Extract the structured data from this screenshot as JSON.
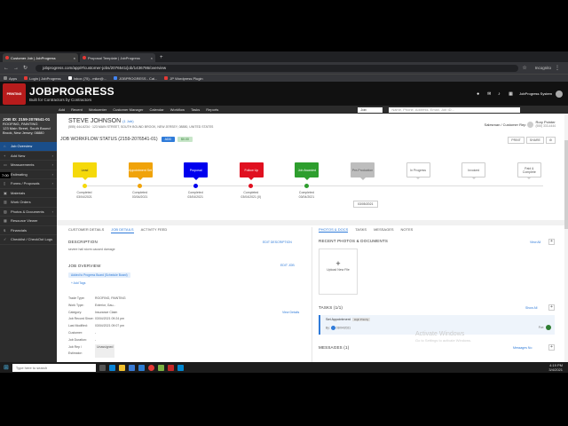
{
  "browser": {
    "tabs": [
      "Customer Job | JobProgress",
      "Proposal Template | JobProgress"
    ],
    "new_tab": "+",
    "url": "jobprogress.com/app/#/customer-jobs/2076541/job/1436786/overview",
    "incognito": "Incognito",
    "bookmarks": [
      "Apps",
      "Login | JobProgress",
      "Inbox (75) - mike@...",
      "JOBPROGRESS - Cal...",
      "JP Wordpress Plugin"
    ]
  },
  "app": {
    "logo": "PRINTING",
    "brand": "JOBPROGRESS",
    "tagline": "Built for Contractors by Contractors",
    "user": "JobProgress System",
    "nav": [
      "Add",
      "Recent",
      "Workcenter",
      "Customer Manager",
      "Calendar",
      "Workflow",
      "Tasks",
      "Reports"
    ],
    "job_select": "Job",
    "search_placeholder": "Name, Phone, Address, Email, Job ID..."
  },
  "sidebar": {
    "job_id": "JOB ID: 2159-2076541-01",
    "job_line2": "ROOFING, PAINTING",
    "address": "123 Main Street, South Bound Brook, New Jersey, 08880",
    "items": [
      "Job Overview",
      "Add New",
      "Measurements",
      "Estimating",
      "Forms / Proposals",
      "Materials",
      "Work Orders",
      "Photos & Documents",
      "Resource Viewer",
      "Financials",
      "Checklist / CheckOut Logs"
    ],
    "time_badge": "7:00"
  },
  "customer": {
    "name": "STEVE JOHNSON",
    "jobs": "(1 Job)",
    "address": "(555) 444-6234 · 123 MAIN STREET, SOUTH BOUND BROOK, NEW JERSEY, 08880, UNITED STATES",
    "rep_label": "Salesman / Customer Rep",
    "rep_name": "Rory Pointer",
    "rep_phone": "(555) 333-4444"
  },
  "workflow": {
    "title": "JOB WORKFLOW STATUS (2159-2076541-01)",
    "add_label": "ADD",
    "badge": "$0.00",
    "print": "PRINT",
    "share": "SHARE",
    "stages": [
      {
        "label": "Lead",
        "color": "#f5d90a",
        "status": "Completed",
        "date": "03/04/2021"
      },
      {
        "label": "Appointment Set",
        "color": "#f0a30a",
        "status": "Completed",
        "date": "03/04/2021"
      },
      {
        "label": "Proposal",
        "color": "#0000ee",
        "status": "Completed",
        "date": "03/04/2021"
      },
      {
        "label": "Follow Up",
        "color": "#e01020",
        "status": "Completed",
        "date": "03/04/2021 (0)"
      },
      {
        "label": "Job Awarded",
        "color": "#2e9e2e",
        "status": "Completed",
        "date": "03/04/2021"
      },
      {
        "label": "Pre-Production",
        "color": "#bdbdbd",
        "status": "",
        "date": ""
      },
      {
        "label": "In Progress",
        "color": "",
        "status": "",
        "date": ""
      },
      {
        "label": "Invoiced",
        "color": "",
        "status": "",
        "date": ""
      },
      {
        "label": "Paid & Complete",
        "color": "",
        "status": "",
        "date": ""
      }
    ],
    "date_popup": "03/05/2021"
  },
  "details": {
    "tabs": [
      "CUSTOMER DETAILS",
      "JOB DETAILS",
      "ACTIVITY FEED"
    ],
    "description_hd": "DESCRIPTION",
    "edit_description": "EDIT DESCRIPTION",
    "description": "severe hail storm caused damage",
    "overview_hd": "JOB OVERVIEW",
    "edit_job": "EDIT JOB",
    "tag": "Added to Progress Board (Schedule Board)",
    "add_tags": "+ Add Tags",
    "view_more": "View Details",
    "rows": [
      {
        "k": "Trade Type:",
        "v": "ROOFING, PAINTING"
      },
      {
        "k": "Work Type:",
        "v": "Exterior, Gau..."
      },
      {
        "k": "Category:",
        "v": "Insurance Claim"
      },
      {
        "k": "Job Record Since:",
        "v": "03/04/2021 09:24 pm"
      },
      {
        "k": "Last Modified:",
        "v": "03/04/2021 09:07 pm"
      },
      {
        "k": "Customer:",
        "v": "-"
      },
      {
        "k": "Job Duration:",
        "v": "-"
      },
      {
        "k": "Job Rep / Estimator:",
        "v": "Unassigned"
      }
    ]
  },
  "right": {
    "tabs": [
      "PHOTOS & DOCS",
      "TASKS",
      "MESSAGES",
      "NOTES"
    ],
    "recent_hd": "RECENT PHOTOS & DOCUMENTS",
    "view_all": "View All",
    "upload": "Upload New File",
    "tasks_hd": "TASKS (1/1)",
    "show_all": "Show All",
    "task_title": "Set Appointment",
    "task_priority": "High Priority",
    "task_by": "By:",
    "task_date": "03/04/2021",
    "task_for": "For:",
    "messages_hd": "MESSAGES (1)",
    "messages_link": "Messages No"
  },
  "activate": {
    "line1": "Activate Windows",
    "line2": "Go to Settings to activate Windows."
  },
  "taskbar": {
    "search": "Type here to search",
    "time": "4:19 PM",
    "date": "3/4/2021"
  }
}
